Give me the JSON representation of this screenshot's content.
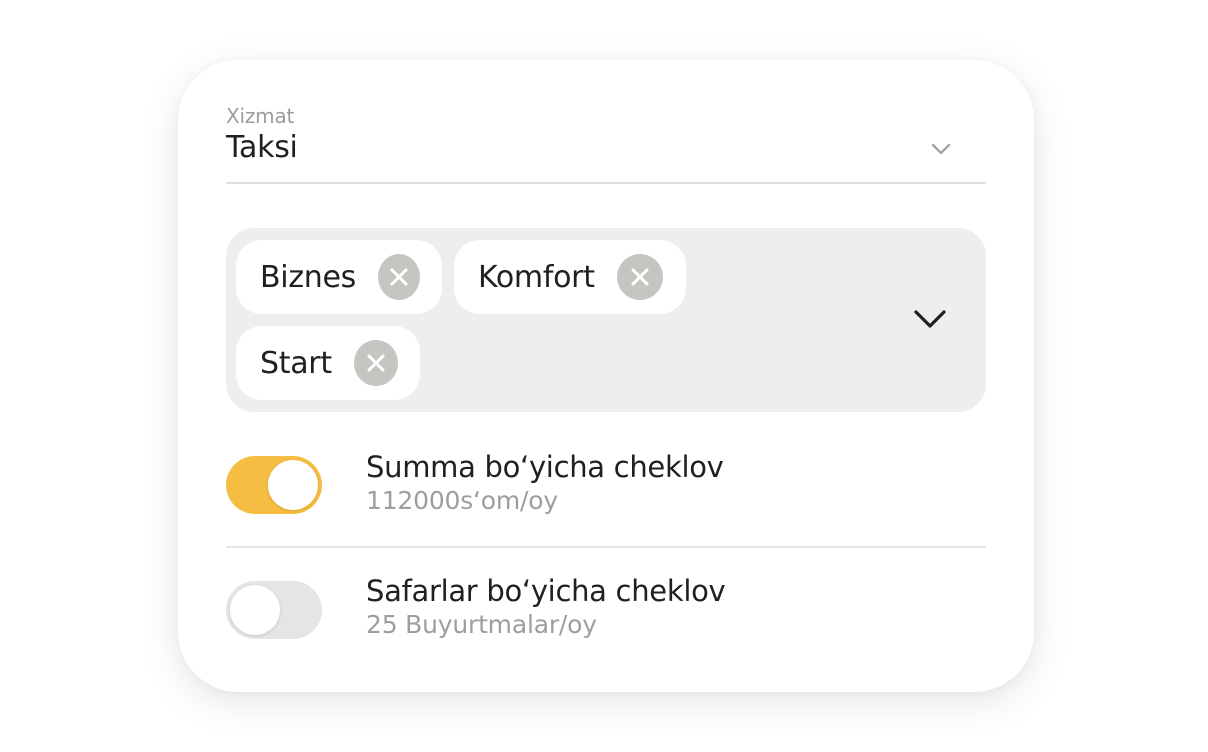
{
  "service_select": {
    "label": "Xizmat",
    "value": "Taksi"
  },
  "tariff_tags": [
    {
      "label": "Biznes"
    },
    {
      "label": "Komfort"
    },
    {
      "label": "Start"
    }
  ],
  "limits": [
    {
      "title": "Summa bo‘yicha cheklov",
      "subtitle": "112000s‘om/oy",
      "enabled": true
    },
    {
      "title": "Safarlar bo‘yicha cheklov",
      "subtitle": "25 Buyurtmalar/oy",
      "enabled": false
    }
  ],
  "colors": {
    "toggle_on": "#f5bd41",
    "toggle_off": "#e6e5e3",
    "tag_box_bg": "#efeeec",
    "chip_remove_bg": "#c7c5c2"
  },
  "icons": {
    "select_chevron": "chevron-down-icon",
    "tags_chevron": "chevron-down-icon",
    "chip_remove": "close-icon"
  }
}
